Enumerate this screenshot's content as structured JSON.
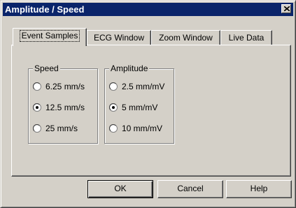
{
  "window": {
    "title": "Amplitude / Speed",
    "close_glyph": "✕"
  },
  "tabs": [
    {
      "label": "Event Samples",
      "active": true
    },
    {
      "label": "ECG Window",
      "active": false
    },
    {
      "label": "Zoom Window",
      "active": false
    },
    {
      "label": "Live Data",
      "active": false
    }
  ],
  "speed_group": {
    "legend": "Speed",
    "options": [
      {
        "label": "6.25 mm/s",
        "selected": false
      },
      {
        "label": "12.5 mm/s",
        "selected": true
      },
      {
        "label": "25 mm/s",
        "selected": false
      }
    ]
  },
  "amplitude_group": {
    "legend": "Amplitude",
    "options": [
      {
        "label": "2.5 mm/mV",
        "selected": false
      },
      {
        "label": "5 mm/mV",
        "selected": true
      },
      {
        "label": "10 mm/mV",
        "selected": false
      }
    ]
  },
  "buttons": {
    "ok": "OK",
    "cancel": "Cancel",
    "help": "Help"
  }
}
